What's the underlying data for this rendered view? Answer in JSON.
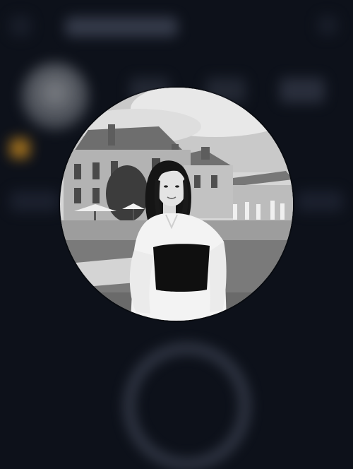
{
  "screen": {
    "title": "",
    "background_color": "#0d111a"
  },
  "avatar_preview": {
    "photo": "profile-photo",
    "style": "grayscale"
  },
  "icons": {
    "back": "back-icon",
    "more": "more-icon"
  }
}
